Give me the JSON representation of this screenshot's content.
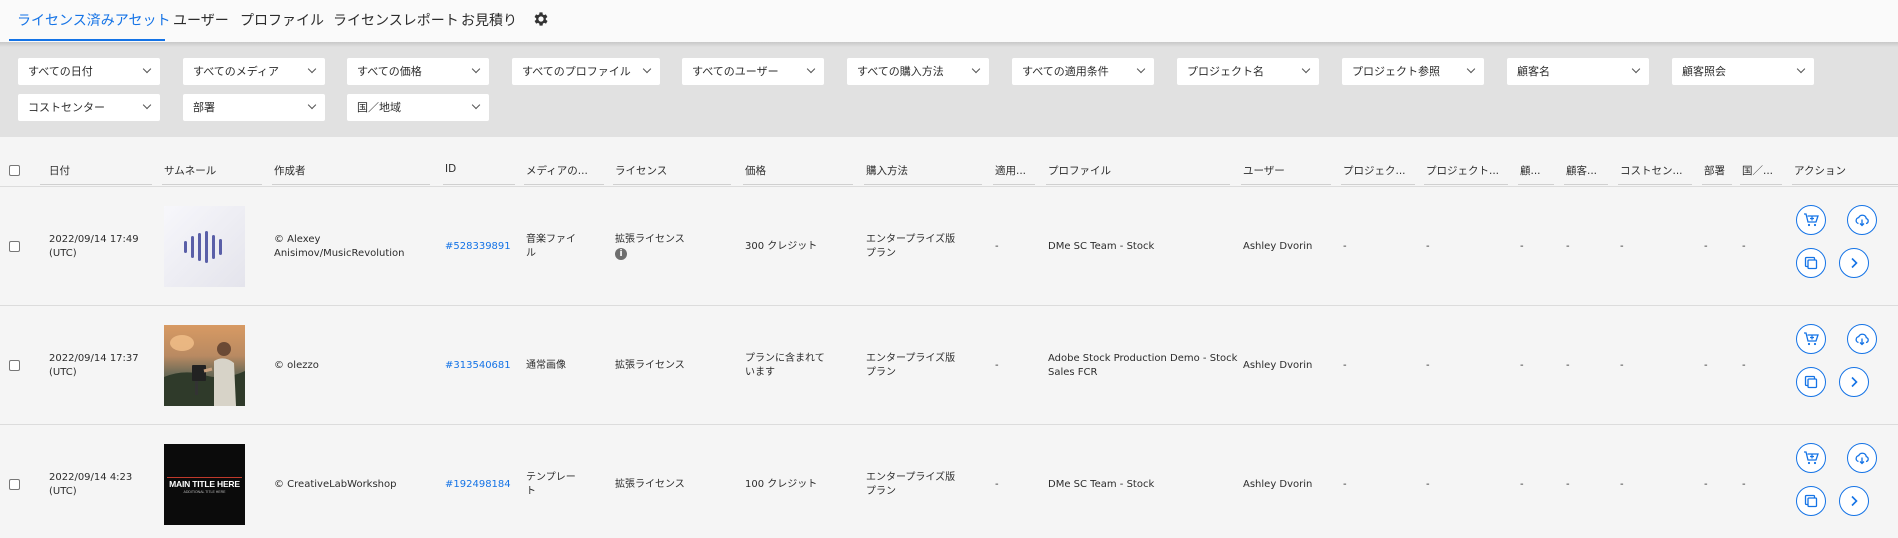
{
  "nav": {
    "tabs": [
      "ライセンス済みアセット",
      "ユーザー",
      "プロファイル",
      "ライセンスレポート",
      "お見積り"
    ],
    "active_index": 0,
    "settings_icon": "gear-icon"
  },
  "filters": [
    "すべての日付",
    "すべてのメディア",
    "すべての価格",
    "すべてのプロファイル",
    "すべてのユーザー",
    "すべての購入方法",
    "すべての適用条件",
    "プロジェクト名",
    "プロジェクト参照",
    "顧客名",
    "顧客照会",
    "コストセンター",
    "部署",
    "国／地域"
  ],
  "table": {
    "headers": [
      "日付",
      "サムネール",
      "作成者",
      "ID",
      "メディアの...",
      "ライセンス",
      "価格",
      "購入方法",
      "適用...",
      "プロファイル",
      "ユーザー",
      "プロジェク...",
      "プロジェクト...",
      "顧...",
      "顧客...",
      "コストセン...",
      "部署",
      "国／...",
      "アクション"
    ],
    "rows": [
      {
        "date1": "2022/09/14 17:49",
        "date2": "(UTC)",
        "thumb": "audio-waveform",
        "author1": "© Alexey",
        "author2": "Anisimov/MusicRevolution",
        "id": "#528339891",
        "media1": "音楽ファイ",
        "media2": "ル",
        "license": "拡張ライセンス",
        "license_info": "i",
        "price1": "300 クレジット",
        "price2": "",
        "purchase1": "エンタープライズ版",
        "purchase2": "プラン",
        "apply": "-",
        "profile1": "DMe SC Team - Stock",
        "profile2": "",
        "user": "Ashley Dvorin",
        "proj_name": "-",
        "proj_ref": "-",
        "cust_name": "-",
        "cust_ref": "-",
        "cost": "-",
        "dept": "-",
        "country": "-"
      },
      {
        "date1": "2022/09/14 17:37",
        "date2": "(UTC)",
        "thumb": "photo-person-landscape",
        "author1": "© olezzo",
        "author2": "",
        "id": "#313540681",
        "media1": "通常画像",
        "media2": "",
        "license": "拡張ライセンス",
        "license_info": "",
        "price1": "プランに含まれて",
        "price2": "います",
        "purchase1": "エンタープライズ版",
        "purchase2": "プラン",
        "apply": "-",
        "profile1": "Adobe Stock Production Demo - Stock",
        "profile2": "Sales FCR",
        "user": "Ashley Dvorin",
        "proj_name": "-",
        "proj_ref": "-",
        "cust_name": "-",
        "cust_ref": "-",
        "cost": "-",
        "dept": "-",
        "country": "-"
      },
      {
        "date1": "2022/09/14 4:23",
        "date2": "(UTC)",
        "thumb": "title-template",
        "thumb_title": "MAIN TITLE HERE",
        "thumb_sub": "ADDITIONAL TITLE HERE",
        "author1": "© CreativeLabWorkshop",
        "author2": "",
        "id": "#192498184",
        "media1": "テンプレー",
        "media2": "ト",
        "license": "拡張ライセンス",
        "license_info": "",
        "price1": "100 クレジット",
        "price2": "",
        "purchase1": "エンタープライズ版",
        "purchase2": "プラン",
        "apply": "-",
        "profile1": "DMe SC Team - Stock",
        "profile2": "",
        "user": "Ashley Dvorin",
        "proj_name": "-",
        "proj_ref": "-",
        "cust_name": "-",
        "cust_ref": "-",
        "cost": "-",
        "dept": "-",
        "country": "-"
      }
    ],
    "action_icons": [
      "add-to-cart-icon",
      "cloud-download-icon",
      "duplicate-icon",
      "chevron-right-icon"
    ]
  },
  "colors": {
    "accent": "#1473e6",
    "filter_bg": "#e1e1e1",
    "page_bg": "#f5f5f5"
  }
}
